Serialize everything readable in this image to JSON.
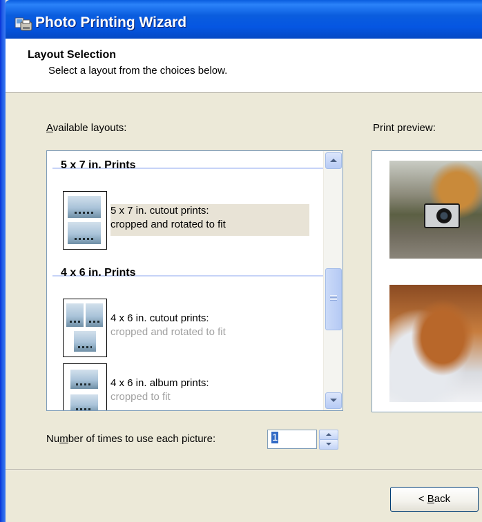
{
  "window": {
    "title": "Photo Printing Wizard",
    "icon": "printer-photo-icon"
  },
  "header": {
    "title": "Layout Selection",
    "subtitle": "Select a layout from the choices below."
  },
  "available_layouts": {
    "label_prefix": "A",
    "label_rest": "vailable layouts:",
    "groups": [
      {
        "title": "5 x 7 in. Prints",
        "items": [
          {
            "line1": "5 x 7 in. cutout prints:",
            "line2": "cropped and rotated to fit",
            "selected": true
          }
        ]
      },
      {
        "title": "4 x 6 in. Prints",
        "items": [
          {
            "line1": "4 x 6 in. cutout prints:",
            "line2": "cropped and rotated to fit",
            "selected": false
          },
          {
            "line1": "4 x 6 in. album prints:",
            "line2": "cropped to fit",
            "selected": false
          }
        ]
      }
    ]
  },
  "print_preview": {
    "label": "Print preview:"
  },
  "copies": {
    "label_pre": "Nu",
    "label_mnemonic": "m",
    "label_post": "ber of times to use each picture:",
    "value": "1"
  },
  "footer": {
    "back_mnemonic": "B",
    "back_rest": "ack",
    "back_prefix": "< "
  },
  "colors": {
    "titlebar": "#0a5dde",
    "selection": "#e8e3d6",
    "dialog_bg": "#ece9d8"
  }
}
